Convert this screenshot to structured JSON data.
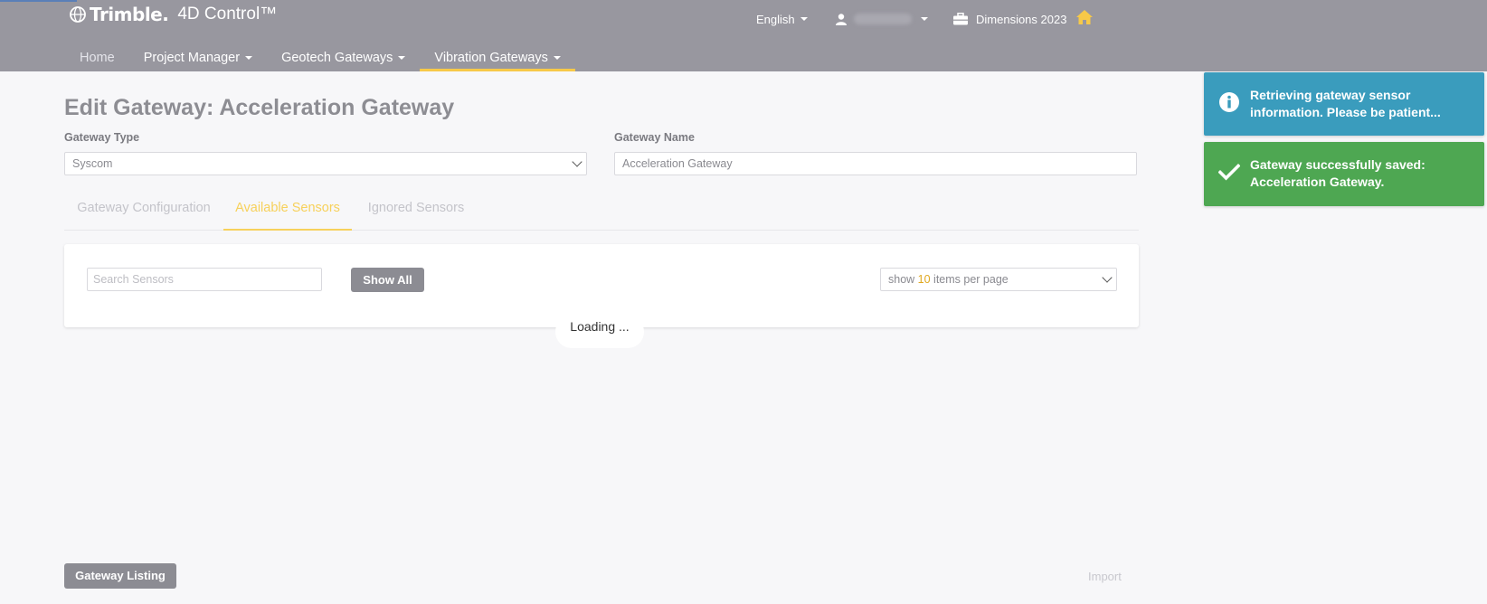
{
  "header": {
    "brand": "Trimble.",
    "product": "4D Control™",
    "language": "English",
    "user": "",
    "project": "Dimensions 2023"
  },
  "nav": [
    {
      "label": "Home"
    },
    {
      "label": "Project Manager"
    },
    {
      "label": "Geotech Gateways"
    },
    {
      "label": "Vibration Gateways"
    }
  ],
  "page": {
    "title": "Edit Gateway: Acceleration Gateway",
    "gateway_type_label": "Gateway Type",
    "gateway_type_value": "Syscom",
    "gateway_name_label": "Gateway Name",
    "gateway_name_value": "Acceleration Gateway"
  },
  "tabs": [
    {
      "label": "Gateway Configuration"
    },
    {
      "label": "Available Sensors"
    },
    {
      "label": "Ignored Sensors"
    }
  ],
  "panel": {
    "search_placeholder": "Search Sensors",
    "show_all": "Show All",
    "perpage_prefix": "show ",
    "perpage_count": "10",
    "perpage_suffix": " items per page",
    "loading": "Loading ..."
  },
  "footer": {
    "gateway_listing": "Gateway Listing",
    "import": "Import"
  },
  "toasts": {
    "info": "Retrieving gateway sensor information. Please be patient...",
    "success": "Gateway successfully saved: Acceleration Gateway."
  },
  "colors": {
    "header_bg": "#98979f",
    "accent_yellow": "#f7c948",
    "info_toast": "#3a9cbd",
    "success_toast": "#4ea752",
    "button_gray": "#8c8c93"
  }
}
